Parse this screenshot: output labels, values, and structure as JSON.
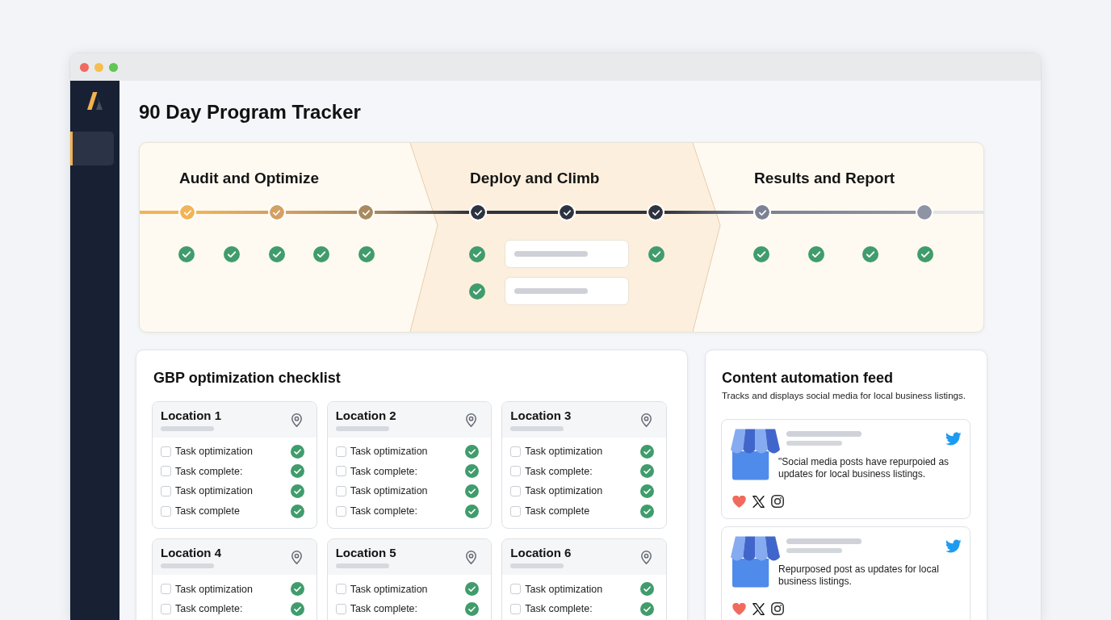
{
  "sidebar": {
    "items": [
      {
        "selected": true
      }
    ]
  },
  "page_title": "90 Day Program Tracker",
  "phases": [
    {
      "title": "Audit and Optimize",
      "current": false,
      "milestones": [
        {
          "done": true,
          "color": "#f2b457"
        },
        {
          "done": true,
          "color": "#d4a063"
        },
        {
          "done": true,
          "color": "#a98a61"
        }
      ],
      "task_rows": [
        [
          {
            "kind": "check",
            "done": true
          },
          {
            "kind": "check",
            "done": true
          },
          {
            "kind": "check",
            "done": true
          },
          {
            "kind": "check",
            "done": true
          },
          {
            "kind": "check",
            "done": true
          }
        ]
      ]
    },
    {
      "title": "Deploy and Climb",
      "current": true,
      "milestones": [
        {
          "done": true,
          "color": "#2d3441"
        },
        {
          "done": true,
          "color": "#2d3441"
        },
        {
          "done": true,
          "color": "#2d3441"
        }
      ],
      "task_rows": [
        [
          {
            "kind": "check",
            "done": true
          },
          {
            "kind": "card"
          },
          {
            "kind": "check",
            "done": true
          }
        ],
        [
          {
            "kind": "check",
            "done": true
          },
          {
            "kind": "card"
          }
        ]
      ]
    },
    {
      "title": "Results and Report",
      "current": false,
      "milestones": [
        {
          "done": true,
          "color": "#7c8193"
        },
        {
          "done": false,
          "color": "#8f94a4"
        }
      ],
      "task_rows": [
        [
          {
            "kind": "check",
            "done": true
          },
          {
            "kind": "check",
            "done": true
          },
          {
            "kind": "check",
            "done": true
          },
          {
            "kind": "check",
            "done": true
          }
        ]
      ]
    }
  ],
  "checklist": {
    "title": "GBP optimization checklist",
    "locations": [
      {
        "name": "Location 1",
        "tasks": [
          {
            "label": "Task optimization",
            "checked": false,
            "done": true
          },
          {
            "label": "Task complete:",
            "checked": false,
            "done": true
          },
          {
            "label": "Task optimization",
            "checked": false,
            "done": true
          },
          {
            "label": "Task complete",
            "checked": false,
            "done": true
          }
        ]
      },
      {
        "name": "Location 2",
        "tasks": [
          {
            "label": "Task optimization",
            "checked": false,
            "done": true
          },
          {
            "label": "Task complete:",
            "checked": false,
            "done": true
          },
          {
            "label": "Task optimization",
            "checked": false,
            "done": true
          },
          {
            "label": "Task complete:",
            "checked": false,
            "done": true
          }
        ]
      },
      {
        "name": "Location 3",
        "tasks": [
          {
            "label": "Task optimization",
            "checked": false,
            "done": true
          },
          {
            "label": "Task complete:",
            "checked": false,
            "done": true
          },
          {
            "label": "Task optimization",
            "checked": false,
            "done": true
          },
          {
            "label": "Task complete",
            "checked": false,
            "done": true
          }
        ]
      },
      {
        "name": "Location 4",
        "tasks": [
          {
            "label": "Task optimization",
            "checked": false,
            "done": true
          },
          {
            "label": "Task complete:",
            "checked": false,
            "done": true
          }
        ]
      },
      {
        "name": "Location 5",
        "tasks": [
          {
            "label": "Task optimization",
            "checked": false,
            "done": true
          },
          {
            "label": "Task complete:",
            "checked": false,
            "done": true
          }
        ]
      },
      {
        "name": "Location 6",
        "tasks": [
          {
            "label": "Task optimization",
            "checked": false,
            "done": true
          },
          {
            "label": "Task complete:",
            "checked": false,
            "done": true
          }
        ]
      }
    ]
  },
  "feed": {
    "title": "Content automation feed",
    "subtitle": "Tracks and displays social media for local business listings.",
    "posts": [
      {
        "text": "\"Social media posts have repurpoied as updates for local business listings.",
        "liked": true
      },
      {
        "text": "Repurposed post as updates for local business listings.",
        "liked": true
      }
    ]
  }
}
